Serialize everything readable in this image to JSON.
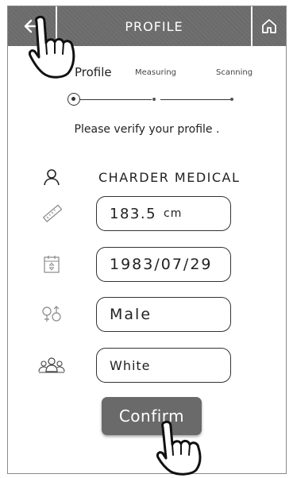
{
  "header": {
    "title": "PROFILE",
    "back_icon": "arrow-left-icon",
    "home_icon": "home-icon"
  },
  "steps": {
    "items": [
      "Profile",
      "Measuring",
      "Scanning"
    ],
    "current": 1
  },
  "instruction": "Please verify your profile .",
  "profile": {
    "name": "CHARDER MEDICAL",
    "height_value": "183.5",
    "height_unit": "cm",
    "birthdate": "1983/07/29",
    "gender": "Male",
    "ethnicity": "White"
  },
  "confirm_label": "Confirm",
  "colors": {
    "header_bg": "#6b6b6b",
    "button_bg": "#6a6a6a",
    "border": "#333333"
  }
}
